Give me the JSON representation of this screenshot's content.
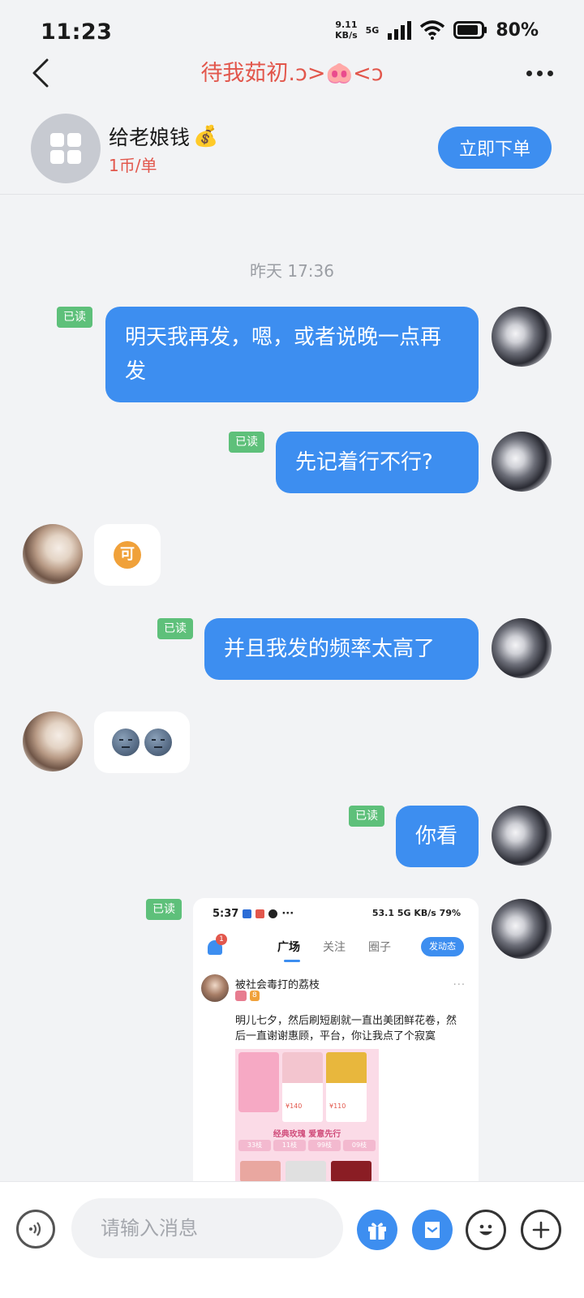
{
  "status_bar": {
    "time": "11:23",
    "net_speed_value": "9.11",
    "net_speed_unit": "KB/s",
    "network_type": "5G",
    "battery": "80%"
  },
  "header": {
    "title": "待我茹初.ↄ>🐽<ↄ",
    "title_color": "#e2574c"
  },
  "service": {
    "name": "给老娘钱",
    "name_emoji": "💰",
    "price": "1币/单",
    "order_button": "立即下单"
  },
  "chat": {
    "timestamp": "昨天 17:36",
    "read_label": "已读",
    "messages": [
      {
        "from": "me",
        "text": "明天我再发，嗯，或者说晚一点再发"
      },
      {
        "from": "me",
        "text": "先记着行不行?"
      },
      {
        "from": "her",
        "emoji": "可"
      },
      {
        "from": "me",
        "text": "并且我发的频率太高了"
      },
      {
        "from": "her",
        "emoji": "moon-face-moon-face"
      },
      {
        "from": "me",
        "text": "你看"
      },
      {
        "from": "me",
        "type": "image"
      }
    ]
  },
  "screenshot": {
    "time": "5:37",
    "status_right": "53.1 5G KB/s 79%",
    "bell_badge": "1",
    "tabs": [
      "广场",
      "关注",
      "圈子"
    ],
    "post_button": "发动态",
    "user": "被社会毒打的荔枝",
    "tag_level": "8",
    "post_text": "明儿七夕，然后刷短剧就一直出美团鲜花卷，然后一直谢谢惠顾，平台，你让我点了个寂寞",
    "prices": [
      "¥140",
      "¥110"
    ],
    "banner": "经典玫瑰 爱意先行",
    "chips": [
      "33枝",
      "11枝",
      "99枝",
      "09枝"
    ]
  },
  "input": {
    "placeholder": "请输入消息"
  },
  "colors": {
    "accent": "#3d8ef0",
    "read_tag": "#5ec07a",
    "price": "#e2574c"
  }
}
